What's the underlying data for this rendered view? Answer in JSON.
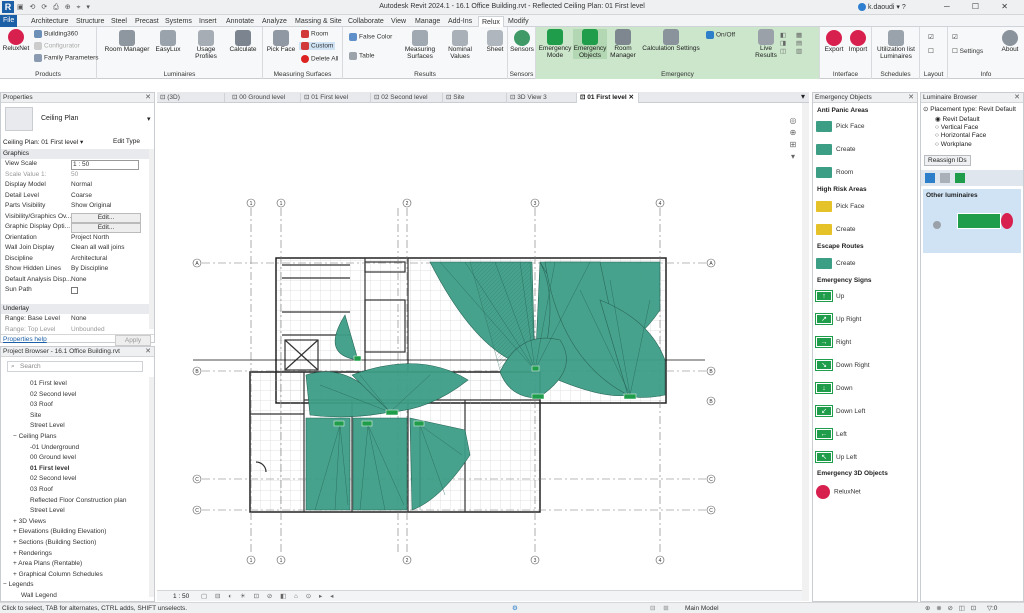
{
  "title": "Autodesk Revit 2024.1 - 16.1 Office Building.rvt - Reflected Ceiling Plan: 01 First level",
  "user": "k.daoudi",
  "menu_tabs": [
    "File",
    "Architecture",
    "Structure",
    "Steel",
    "Precast",
    "Systems",
    "Insert",
    "Annotate",
    "Analyze",
    "Massing & Site",
    "Collaborate",
    "View",
    "Manage",
    "Add-Ins",
    "Relux",
    "Modify"
  ],
  "active_tab": "Relux",
  "ribbon": {
    "products": {
      "label": "Products",
      "relux_net": "ReluxNet",
      "building360": "Building360",
      "configurator": "Configurator",
      "family_params": "Family Parameters"
    },
    "luminaires": {
      "label": "Luminaires",
      "room_manager": "Room Manager",
      "easylux": "EasyLux",
      "usage_profiles": "Usage Profiles",
      "calculate": "Calculate"
    },
    "measuring": {
      "label": "Measuring Surfaces",
      "pick_face": "Pick Face",
      "room": "Room",
      "custom": "Custom",
      "delete_all": "Delete All"
    },
    "results": {
      "label": "Results",
      "false_color": "False Color",
      "table": "Table",
      "measuring_surfaces": "Measuring Surfaces",
      "nominal_values": "Nominal Values",
      "sheet": "Sheet"
    },
    "sensors": {
      "label": "Sensors",
      "sensors": "Sensors"
    },
    "emergency": {
      "label": "Emergency",
      "emergency_mode": "Emergency Mode",
      "emergency_objects": "Emergency Objects",
      "room_manager": "Room Manager",
      "calc_settings": "Calculation Settings",
      "on_off": "On/Off",
      "live_results": "Live Results"
    },
    "interface": {
      "label": "Interface",
      "export": "Export",
      "import": "Import"
    },
    "schedules": {
      "label": "Schedules",
      "utilization": "Utilization list Luminaires"
    },
    "layout": {
      "label": "Layout"
    },
    "info": {
      "label": "Info",
      "settings": "Settings",
      "about": "About"
    }
  },
  "properties": {
    "title": "Properties",
    "type": "Ceiling Plan",
    "selector": "Ceiling Plan: 01 First level",
    "edit_type": "Edit Type",
    "section": "Graphics",
    "rows": [
      {
        "k": "View Scale",
        "v": "1 : 50"
      },
      {
        "k": "Scale Value    1:",
        "v": "50"
      },
      {
        "k": "Display Model",
        "v": "Normal"
      },
      {
        "k": "Detail Level",
        "v": "Coarse"
      },
      {
        "k": "Parts Visibility",
        "v": "Show Original"
      },
      {
        "k": "Visibility/Graphics Ov...",
        "v": "Edit..."
      },
      {
        "k": "Graphic Display Opti...",
        "v": "Edit..."
      },
      {
        "k": "Orientation",
        "v": "Project North"
      },
      {
        "k": "Wall Join Display",
        "v": "Clean all wall joins"
      },
      {
        "k": "Discipline",
        "v": "Architectural"
      },
      {
        "k": "Show Hidden Lines",
        "v": "By Discipline"
      },
      {
        "k": "Default Analysis Disp...",
        "v": "None"
      },
      {
        "k": "Sun Path",
        "v": ""
      }
    ],
    "section2": "Underlay",
    "rows2": [
      {
        "k": "Range: Base Level",
        "v": "None"
      },
      {
        "k": "Range: Top Level",
        "v": "Unbounded"
      }
    ],
    "help": "Properties help",
    "apply": "Apply"
  },
  "browser": {
    "title": "Project Browser - 16.1 Office Building.rvt",
    "search": "Search",
    "items": [
      "01 First level",
      "02 Second level",
      "03 Roof",
      "Site",
      "Street Level",
      "Ceiling Plans",
      "-01 Underground",
      "00 Ground level",
      "01 First level",
      "02 Second level",
      "03 Roof",
      "Reflected Floor Construction plan",
      "Street Level",
      "3D Views",
      "Elevations (Building Elevation)",
      "Sections (Building Section)",
      "Renderings",
      "Area Plans (Rentable)",
      "Graphical Column Schedules",
      "Legends",
      "Wall Legend"
    ]
  },
  "view_tabs": [
    "(3D)",
    "00 Ground level",
    "01 First level",
    "02 Second level",
    "Site",
    "3D View 3",
    "01 First level"
  ],
  "view": {
    "scale": "1 : 50",
    "grid_top": [
      "1",
      "1",
      "2",
      "3",
      "4"
    ],
    "grid_side": [
      "A",
      "B",
      "C",
      "C"
    ],
    "grid_side_r": [
      "A",
      "B",
      "B",
      "C",
      "C"
    ]
  },
  "emergency_objects": {
    "title": "Emergency Objects",
    "sections": [
      {
        "h": "Anti Panic Areas",
        "items": [
          "Pick Face",
          "Create",
          "Room"
        ]
      },
      {
        "h": "High Risk Areas",
        "items": [
          "Pick Face",
          "Create"
        ]
      },
      {
        "h": "Escape Routes",
        "items": [
          "Create"
        ]
      },
      {
        "h": "Emergency Signs",
        "items": [
          "Up",
          "Up Right",
          "Right",
          "Down Right",
          "Down",
          "Down Left",
          "Left",
          "Up Left"
        ]
      },
      {
        "h": "Emergency 3D Objects",
        "items": [
          "ReluxNet"
        ]
      }
    ]
  },
  "luminaire_browser": {
    "title": "Luminaire Browser",
    "placement_label": "Placement type: Revit Default",
    "options": [
      "Revit Default",
      "Vertical Face",
      "Horizontal Face",
      "Workplane"
    ],
    "reassign": "Reassign IDs",
    "other": "Other luminaires"
  },
  "status": {
    "text": "Click to select, TAB for alternates, CTRL adds, SHIFT unselects.",
    "model": "Main Model",
    "filter": ":0"
  },
  "colors": {
    "accent": "#1b5fa6",
    "emergency_green": "#cbe6cb",
    "cone_fill": "#3d9e86",
    "sign_green": "#1f9d4a"
  }
}
